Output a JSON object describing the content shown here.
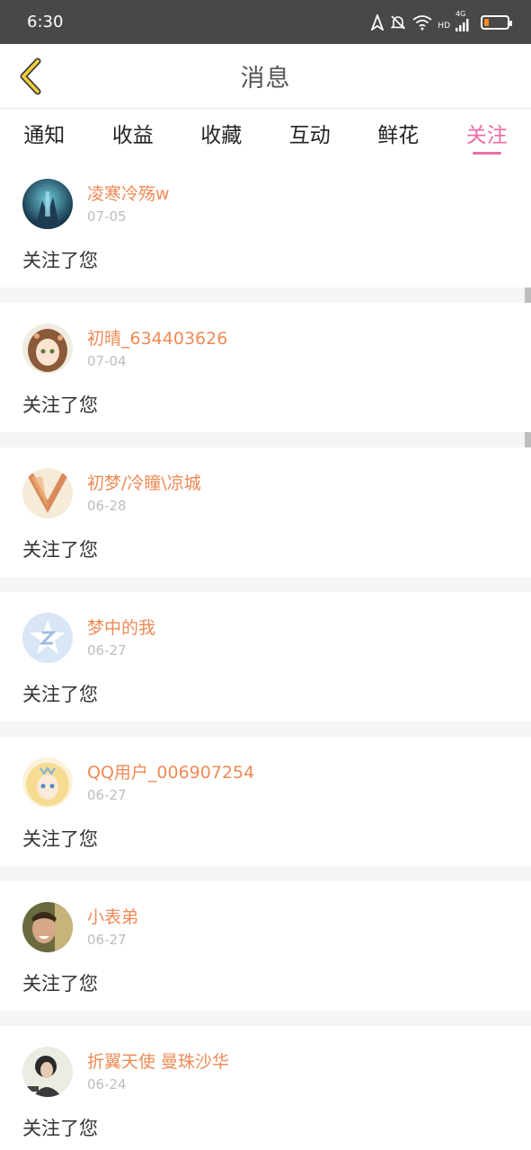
{
  "status": {
    "time": "6:30",
    "network": "4G",
    "hd": "HD"
  },
  "nav": {
    "title": "消息"
  },
  "tabs": [
    {
      "label": "通知"
    },
    {
      "label": "收益"
    },
    {
      "label": "收藏"
    },
    {
      "label": "互动"
    },
    {
      "label": "鲜花"
    },
    {
      "label": "关注",
      "active": true
    }
  ],
  "colors": {
    "accent": "#ec6ca6",
    "username": "#ef8a55",
    "date": "#bdbdbd",
    "statusbar": "#484848"
  },
  "follows": [
    {
      "name": "凌寒冷殇w",
      "date": "07-05",
      "message": "关注了您"
    },
    {
      "name": "初晴_634403626",
      "date": "07-04",
      "message": "关注了您"
    },
    {
      "name": "初梦/冷瞳\\凉城",
      "date": "06-28",
      "message": "关注了您"
    },
    {
      "name": "梦中的我",
      "date": "06-27",
      "message": "关注了您"
    },
    {
      "name": "QQ用户_006907254",
      "date": "06-27",
      "message": "关注了您"
    },
    {
      "name": "小表弟",
      "date": "06-27",
      "message": "关注了您"
    },
    {
      "name": "折翼天使 曼珠沙华",
      "date": "06-24",
      "message": "关注了您"
    }
  ]
}
